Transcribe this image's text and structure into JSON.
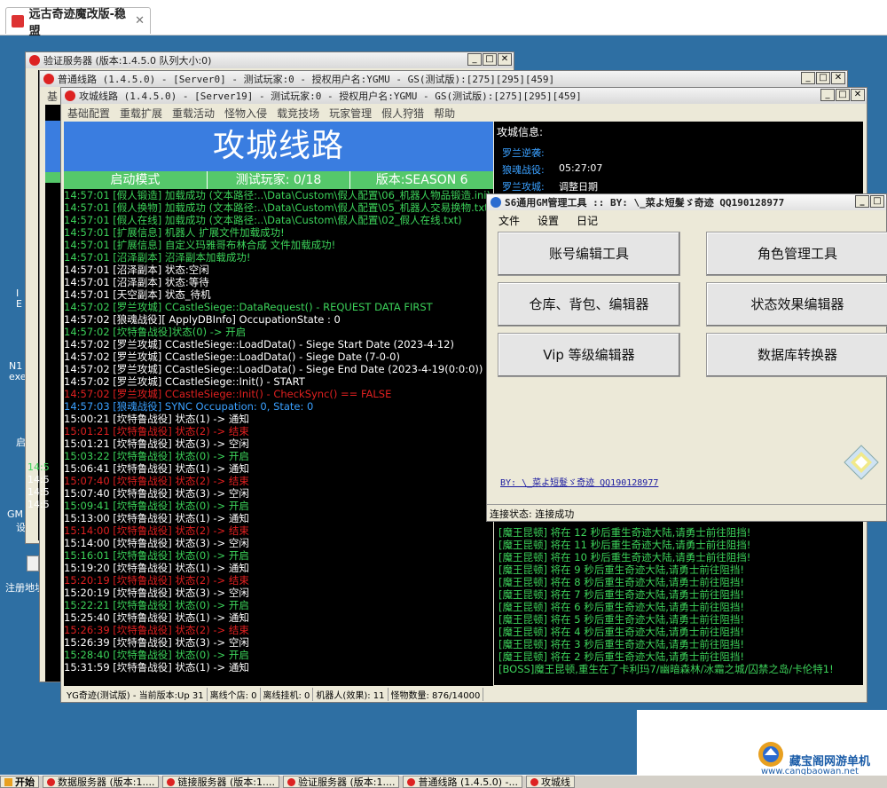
{
  "browser_tab": {
    "title": "远古奇迹魔改版-稳盟",
    "close": "✕"
  },
  "desktop": {
    "icon_labels": [
      "I",
      "E",
      "N1",
      "exe",
      "启",
      "GM",
      "设",
      "注册地址"
    ],
    "side_times": [
      "14:5",
      "14:5",
      "14:5",
      "14:5"
    ]
  },
  "win_verify": {
    "title": "验证服务器 (版本:1.4.5.0 队列大小:0)"
  },
  "win_normal": {
    "title": "普通线路 (1.4.5.0) - [Server0] - 测试玩家:0 - 授权用户名:YGMU - GS(测试版):[275][295][459]",
    "side_label": "基"
  },
  "win_main": {
    "title": "攻城线路 (1.4.5.0) - [Server19] - 测试玩家:0 - 授权用户名:YGMU - GS(测试版):[275][295][459]",
    "menu": [
      "基础配置",
      "重载扩展",
      "重载活动",
      "怪物入侵",
      "载竞技场",
      "玩家管理",
      "假人狩猎",
      "帮助"
    ],
    "banner": "攻城线路",
    "status": [
      "启动模式",
      "测试玩家: 0/18",
      "版本:SEASON 6"
    ],
    "colors": {
      "green": "#3cd35a",
      "white": "#ffffff",
      "red": "#e02020",
      "blue": "#3aa0ff"
    },
    "log": [
      {
        "c": "green",
        "t": "14:57:01 [假人锻造] 加载成功 (文本路径:..\\Data\\Custom\\假人配置\\06_机器人物品锻造.ini)"
      },
      {
        "c": "green",
        "t": "14:57:01 [假人换物] 加载成功 (文本路径:..\\Data\\Custom\\假人配置\\05_机器人交易换物.txt)"
      },
      {
        "c": "green",
        "t": "14:57:01 [假人在线] 加载成功 (文本路径:..\\Data\\Custom\\假人配置\\02_假人在线.txt)"
      },
      {
        "c": "green",
        "t": "14:57:01 [扩展信息] 机器人 扩展文件加载成功!"
      },
      {
        "c": "green",
        "t": "14:57:01 [扩展信息] 自定义玛雅哥布林合成 文件加载成功!"
      },
      {
        "c": "green",
        "t": "14:57:01 [沼泽副本] 沼泽副本加载成功!"
      },
      {
        "c": "white",
        "t": "14:57:01 [沼泽副本] 状态:空闲"
      },
      {
        "c": "white",
        "t": "14:57:01 [沼泽副本] 状态:等待"
      },
      {
        "c": "white",
        "t": "14:57:01 [天空副本] 状态_待机"
      },
      {
        "c": "green",
        "t": "14:57:02 [罗兰攻城] CCastleSiege::DataRequest() - REQUEST DATA FIRST"
      },
      {
        "c": "white",
        "t": "14:57:02 [狼魂战役][ ApplyDBInfo] OccupationState : 0"
      },
      {
        "c": "green",
        "t": "14:57:02 [坎特鲁战役]状态(0) -> 开启"
      },
      {
        "c": "white",
        "t": "14:57:02 [罗兰攻城] CCastleSiege::LoadData() - Siege Start Date (2023-4-12)"
      },
      {
        "c": "white",
        "t": "14:57:02 [罗兰攻城] CCastleSiege::LoadData() - Siege Date (7-0-0)"
      },
      {
        "c": "white",
        "t": "14:57:02 [罗兰攻城] CCastleSiege::LoadData() - Siege End Date (2023-4-19(0:0:0))"
      },
      {
        "c": "white",
        "t": "14:57:02 [罗兰攻城] CCastleSiege::Init() - START"
      },
      {
        "c": "red",
        "t": "14:57:02 [罗兰攻城] CCastleSiege::Init() - CheckSync() == FALSE"
      },
      {
        "c": "blue",
        "t": "14:57:03 [狼魂战役] SYNC Occupation: 0, State: 0"
      },
      {
        "c": "white",
        "t": "15:00:21 [坎特鲁战役] 状态(1) -> 通知"
      },
      {
        "c": "red",
        "t": "15:01:21 [坎特鲁战役] 状态(2) -> 结束"
      },
      {
        "c": "white",
        "t": "15:01:21 [坎特鲁战役] 状态(3) -> 空闲"
      },
      {
        "c": "green",
        "t": "15:03:22 [坎特鲁战役] 状态(0) -> 开启"
      },
      {
        "c": "white",
        "t": "15:06:41 [坎特鲁战役] 状态(1) -> 通知"
      },
      {
        "c": "red",
        "t": "15:07:40 [坎特鲁战役] 状态(2) -> 结束"
      },
      {
        "c": "white",
        "t": "15:07:40 [坎特鲁战役] 状态(3) -> 空闲"
      },
      {
        "c": "green",
        "t": "15:09:41 [坎特鲁战役] 状态(0) -> 开启"
      },
      {
        "c": "white",
        "t": "15:13:00 [坎特鲁战役] 状态(1) -> 通知"
      },
      {
        "c": "red",
        "t": "15:14:00 [坎特鲁战役] 状态(2) -> 结束"
      },
      {
        "c": "white",
        "t": "15:14:00 [坎特鲁战役] 状态(3) -> 空闲"
      },
      {
        "c": "green",
        "t": "15:16:01 [坎特鲁战役] 状态(0) -> 开启"
      },
      {
        "c": "white",
        "t": "15:19:20 [坎特鲁战役] 状态(1) -> 通知"
      },
      {
        "c": "red",
        "t": "15:20:19 [坎特鲁战役] 状态(2) -> 结束"
      },
      {
        "c": "white",
        "t": "15:20:19 [坎特鲁战役] 状态(3) -> 空闲"
      },
      {
        "c": "green",
        "t": "15:22:21 [坎特鲁战役] 状态(0) -> 开启"
      },
      {
        "c": "white",
        "t": "15:25:40 [坎特鲁战役] 状态(1) -> 通知"
      },
      {
        "c": "red",
        "t": "15:26:39 [坎特鲁战役] 状态(2) -> 结束"
      },
      {
        "c": "white",
        "t": "15:26:39 [坎特鲁战役] 状态(3) -> 空闲"
      },
      {
        "c": "green",
        "t": "15:28:40 [坎特鲁战役] 状态(0) -> 开启"
      },
      {
        "c": "white",
        "t": "15:31:59 [坎特鲁战役] 状态(1) -> 通知"
      }
    ],
    "bottom": [
      "YG奇迹(测试版) - 当前版本:Up 31",
      "离线个店: 0",
      "离线挂机: 0",
      "机器人(效果): 11",
      "怪物数量: 876/14000"
    ],
    "right_info": {
      "heading": "攻城信息:",
      "rows": [
        {
          "k": "罗兰逆袭:",
          "v": ""
        },
        {
          "k": "狼魂战役:",
          "v": "05:27:07"
        },
        {
          "k": "罗兰攻城:",
          "v": "调整日期"
        }
      ]
    },
    "right_log": [
      "[魔王昆顿] 将在 12 秒后重生奇迹大陆,请勇士前往阻挡!",
      "[魔王昆顿] 将在 11 秒后重生奇迹大陆,请勇士前往阻挡!",
      "[魔王昆顿] 将在 10 秒后重生奇迹大陆,请勇士前往阻挡!",
      "[魔王昆顿] 将在 9 秒后重生奇迹大陆,请勇士前往阻挡!",
      "[魔王昆顿] 将在 8 秒后重生奇迹大陆,请勇士前往阻挡!",
      "[魔王昆顿] 将在 7 秒后重生奇迹大陆,请勇士前往阻挡!",
      "[魔王昆顿] 将在 6 秒后重生奇迹大陆,请勇士前往阻挡!",
      "[魔王昆顿] 将在 5 秒后重生奇迹大陆,请勇士前往阻挡!",
      "[魔王昆顿] 将在 4 秒后重生奇迹大陆,请勇士前往阻挡!",
      "[魔王昆顿] 将在 3 秒后重生奇迹大陆,请勇士前往阻挡!",
      "[魔王昆顿] 将在 2 秒后重生奇迹大陆,请勇士前往阻挡!",
      "[BOSS]魔王昆顿,重生在了卡利玛7/幽暗森林/冰霜之城/囚禁之岛/卡伦特1!"
    ]
  },
  "gm": {
    "title": "S6通用GM管理工具 :: BY: \\_菜よ短髮ゞ奇迹 QQ190128977",
    "menu": [
      "文件",
      "设置",
      "日记"
    ],
    "buttons": [
      "账号编辑工具",
      "角色管理工具",
      "仓库、背包、编辑器",
      "状态效果编辑器",
      "Vip 等级编辑器",
      "数据库转换器"
    ],
    "link": "BY: \\_菜よ短髮ゞ奇迹 QQ190128977",
    "status": "连接状态: 连接成功"
  },
  "window_buttons": {
    "min": "_",
    "max": "□",
    "close": "✕"
  },
  "taskbar": {
    "start": "开始",
    "items": [
      "数据服务器 (版本:1....",
      "链接服务器 (版本:1....",
      "验证服务器 (版本:1....",
      "普通线路 (1.4.5.0) -...",
      "攻城线"
    ]
  },
  "watermark": {
    "line1": "藏宝阁网游单机",
    "line2": "www.cangbaowan.net"
  }
}
